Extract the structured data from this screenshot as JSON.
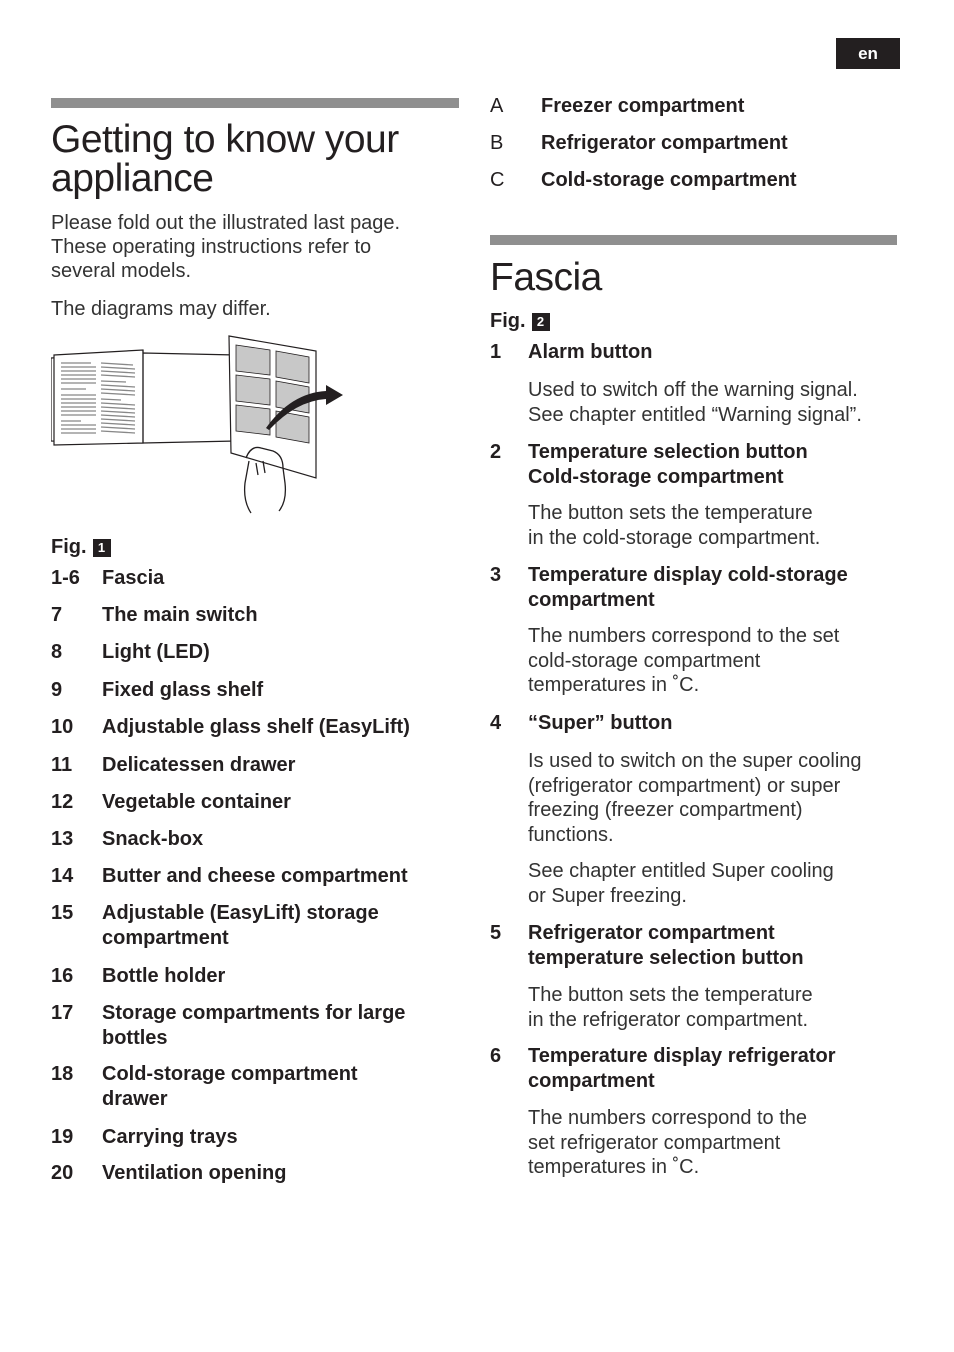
{
  "header": {
    "language_tab": "en"
  },
  "left": {
    "title_line1": "Getting to know your",
    "title_line2": "appliance",
    "intro": [
      "Please  fold out the illustrated last page.",
      "These operating instructions refer to",
      "several  models."
    ],
    "note": "The diagrams may differ.",
    "illustration_alt": "fold-out-page-illustration",
    "figure": {
      "label": "Fig.",
      "number": "1"
    },
    "items": [
      {
        "num": "1-6",
        "lines": [
          "Fascia"
        ]
      },
      {
        "num": "7",
        "lines": [
          "The main switch"
        ]
      },
      {
        "num": "8",
        "lines": [
          "Light (LED)"
        ]
      },
      {
        "num": "9",
        "lines": [
          "Fixed glass shelf"
        ]
      },
      {
        "num": "10",
        "lines": [
          "Adjustable glass shelf (EasyLift)"
        ]
      },
      {
        "num": "11",
        "lines": [
          "Delicatessen drawer"
        ]
      },
      {
        "num": "12",
        "lines": [
          "Vegetable container"
        ]
      },
      {
        "num": "13",
        "lines": [
          "Snack-box"
        ]
      },
      {
        "num": "14",
        "lines": [
          "Butter and cheese compartment"
        ]
      },
      {
        "num": "15",
        "lines": [
          "Adjustable (EasyLift) storage",
          "compartment"
        ]
      },
      {
        "num": "16",
        "lines": [
          "Bottle holder"
        ]
      },
      {
        "num": "17",
        "lines": [
          "Storage compartments for large",
          "bottles"
        ]
      },
      {
        "num": "18",
        "lines": [
          "Cold-storage compartment",
          "drawer"
        ]
      },
      {
        "num": "19",
        "lines": [
          "Carrying trays"
        ]
      },
      {
        "num": "20",
        "lines": [
          "Ventilation opening"
        ]
      }
    ]
  },
  "right": {
    "compartments": [
      {
        "letter": "A",
        "label": "Freezer compartment"
      },
      {
        "letter": "B",
        "label": "Refrigerator compartment"
      },
      {
        "letter": "C",
        "label": "Cold-storage compartment"
      }
    ],
    "title": "Fascia",
    "figure": {
      "label": "Fig.",
      "number": "2"
    },
    "items": [
      {
        "num": "1",
        "lines": [
          "Alarm button"
        ],
        "desc": [
          [
            "Used  to switch off the warning signal.",
            "See chapter entitled “Warning signal”."
          ]
        ]
      },
      {
        "num": "2",
        "lines": [
          "Temperature selection button",
          "Cold-storage compartment"
        ],
        "desc": [
          [
            "The button sets the temperature",
            "in the cold-storage   compartment."
          ]
        ]
      },
      {
        "num": "3",
        "lines": [
          "Temperature display cold-storage",
          "compartment"
        ],
        "desc": [
          [
            "The numbers correspond to the set",
            "cold-storage  compartment",
            "temperatures in ˚C."
          ]
        ]
      },
      {
        "num": "4",
        "lines": [
          "“Super” button"
        ],
        "desc": [
          [
            "Is used to switch on the super cooling",
            "(refrigerator  compartment) or super",
            "freezing  (freezer  compartment)",
            "functions."
          ],
          [
            "See chapter entitled Super cooling",
            "or Super  freezing."
          ]
        ]
      },
      {
        "num": "5",
        "lines": [
          "Refrigerator compartment",
          "temperature selection button"
        ],
        "desc": [
          [
            "The button sets the temperature",
            "in the refrigerator   compartment."
          ]
        ]
      },
      {
        "num": "6",
        "lines": [
          "Temperature display refrigerator",
          "compartment"
        ],
        "desc": [
          [
            "The numbers correspond to the",
            "set refrigerator  compartment",
            "temperatures in ˚C."
          ]
        ]
      }
    ]
  }
}
